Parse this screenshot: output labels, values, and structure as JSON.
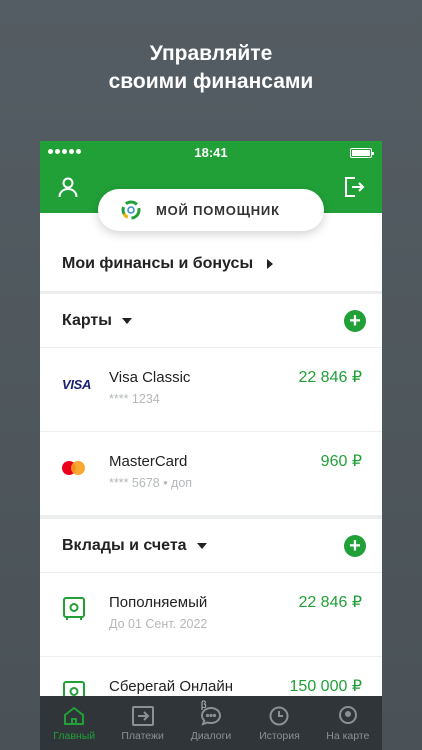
{
  "promo": {
    "line1": "Управляйте",
    "line2": "своими финансами"
  },
  "status_bar": {
    "time": "18:41"
  },
  "header": {
    "assistant_label": "МОЙ ПОМОЩНИК",
    "left_icon": "profile-icon",
    "right_icon": "logout-icon"
  },
  "finance": {
    "label": "Мои финансы и бонусы"
  },
  "cards": {
    "title": "Карты",
    "items": [
      {
        "brand": "VISA",
        "name": "Visa Classic",
        "number": "**** 1234",
        "amount": "22 846 ₽"
      },
      {
        "brand": "mastercard",
        "name": "MasterCard",
        "number": "**** 5678 • доп",
        "amount": "960 ₽"
      }
    ]
  },
  "deposits": {
    "title": "Вклады и счета",
    "items": [
      {
        "icon": "safe-icon",
        "name": "Пополняемый",
        "sub": "До 01 Сент. 2022",
        "amount": "22 846 ₽"
      },
      {
        "icon": "safe-icon",
        "name": "Сберегай Онлайн",
        "sub": "",
        "amount": "150 000 ₽"
      }
    ]
  },
  "tabbar": {
    "tabs": [
      {
        "label": "Главный",
        "icon": "home-icon",
        "active": true
      },
      {
        "label": "Платежи",
        "icon": "transfer-icon",
        "active": false
      },
      {
        "label": "Диалоги",
        "icon": "chat-icon",
        "badge": "β",
        "active": false
      },
      {
        "label": "История",
        "icon": "clock-icon",
        "active": false
      },
      {
        "label": "На карте",
        "icon": "map-pin-icon",
        "active": false
      }
    ]
  },
  "colors": {
    "brand_green": "#21a038",
    "tabbar_bg": "#2f3538",
    "background": "#545d63"
  }
}
